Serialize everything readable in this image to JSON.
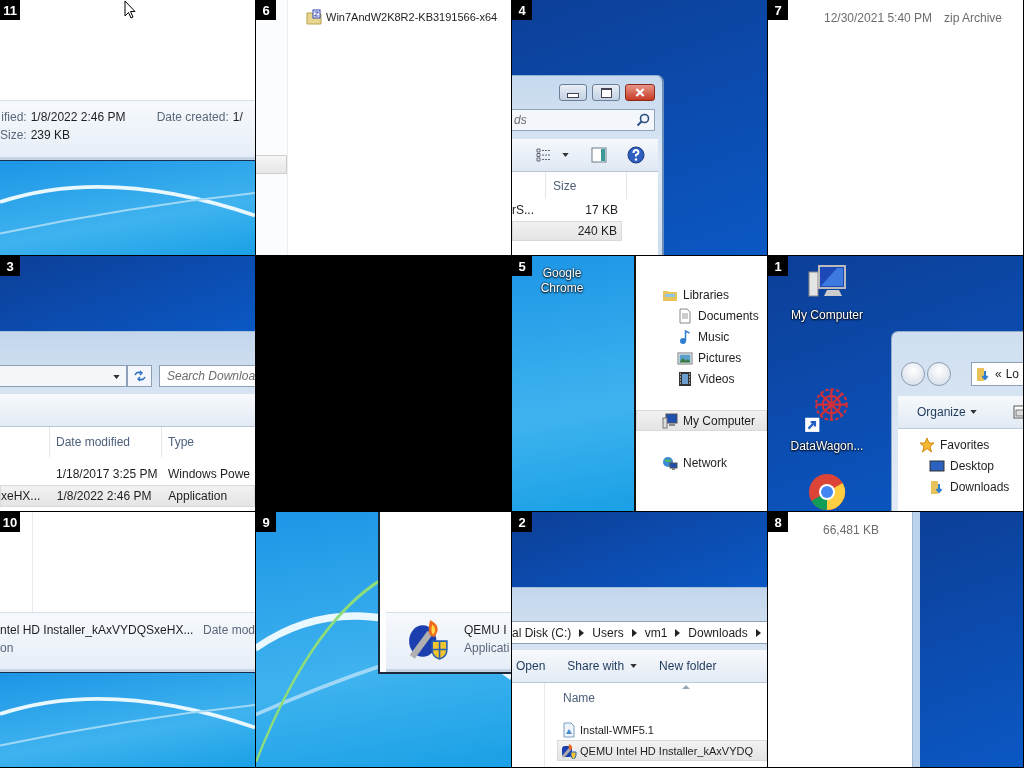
{
  "tiles": [
    {
      "number": "11",
      "kind": "details-pane",
      "fields": [
        {
          "label": "ified:",
          "value": "1/8/2022 2:46 PM"
        },
        {
          "label": "Date created:",
          "value": "1/"
        },
        {
          "label": "Size:",
          "value": "239 KB"
        }
      ]
    },
    {
      "number": "6",
      "kind": "zip-file-row",
      "file": {
        "name": "Win7AndW2K8R2-KB3191566-x64",
        "kind": "zip"
      }
    },
    {
      "number": "4",
      "kind": "window-corner",
      "search_placeholder": "ds",
      "column": "Size",
      "rows": [
        {
          "name": "rS...",
          "size": "17 KB",
          "selected": false
        },
        {
          "size": "240 KB",
          "selected": true
        }
      ]
    },
    {
      "number": "7",
      "kind": "file-dates",
      "date": "12/30/2021 5:40 PM",
      "type": "zip Archive"
    },
    {
      "number": "3",
      "kind": "address-bar",
      "search_placeholder": "Search Downloa",
      "columns": [
        "Date modified",
        "Type"
      ],
      "rows": [
        {
          "date": "1/18/2017 3:25 PM",
          "type": "Windows Powe",
          "selected": false
        },
        {
          "name": "xeHX...",
          "date": "1/8/2022 2:46 PM",
          "type": "Application",
          "selected": true
        }
      ]
    },
    {
      "kind": "empty"
    },
    {
      "number": "5",
      "kind": "nav-pane",
      "desktop_label": "Google Chrome",
      "items": [
        {
          "label": "Libraries",
          "kind": "library",
          "selected": false,
          "children": [
            {
              "label": "Documents",
              "kind": "documents",
              "selected": false
            },
            {
              "label": "Music",
              "kind": "music",
              "selected": false
            },
            {
              "label": "Pictures",
              "kind": "pictures",
              "selected": false
            },
            {
              "label": "Videos",
              "kind": "videos",
              "selected": false
            }
          ]
        },
        {
          "label": "My Computer",
          "kind": "computer",
          "selected": true
        },
        {
          "label": "Network",
          "kind": "network",
          "selected": false
        }
      ]
    },
    {
      "number": "1",
      "kind": "desktop-window",
      "icons": [
        {
          "label": "My Computer",
          "kind": "computer"
        },
        {
          "label": "DataWagon...",
          "kind": "datawagon"
        },
        {
          "kind": "chrome"
        }
      ],
      "address": [
        "«",
        "Lo"
      ],
      "toolbar": "Organize",
      "nav": [
        {
          "label": "Favorites",
          "kind": "favorites",
          "children": [
            {
              "label": "Desktop",
              "kind": "desktop"
            },
            {
              "label": "Downloads",
              "kind": "downloads"
            }
          ]
        }
      ]
    },
    {
      "number": "10",
      "kind": "details-name",
      "name": "ntel HD Installer_kAxVYDQSxeHX...",
      "label": "Date mod",
      "type": "on"
    },
    {
      "number": "9",
      "kind": "details-app",
      "name": "QEMU I",
      "type": "Applicati"
    },
    {
      "number": "2",
      "kind": "breadcrumb",
      "path": [
        "al Disk (C:)",
        "Users",
        "vm1",
        "Downloads"
      ],
      "toolbar": [
        {
          "label": "Open",
          "menu": false
        },
        {
          "label": "Share with",
          "menu": true
        },
        {
          "label": "New folder",
          "menu": false
        }
      ],
      "column": "Name",
      "files": [
        {
          "name": "Install-WMF5.1",
          "kind": "script",
          "selected": false
        },
        {
          "name": "QEMU Intel HD Installer_kAxVYDQ",
          "kind": "installer",
          "selected": true
        }
      ]
    },
    {
      "number": "8",
      "kind": "file-size",
      "size": "66,481 KB"
    }
  ]
}
